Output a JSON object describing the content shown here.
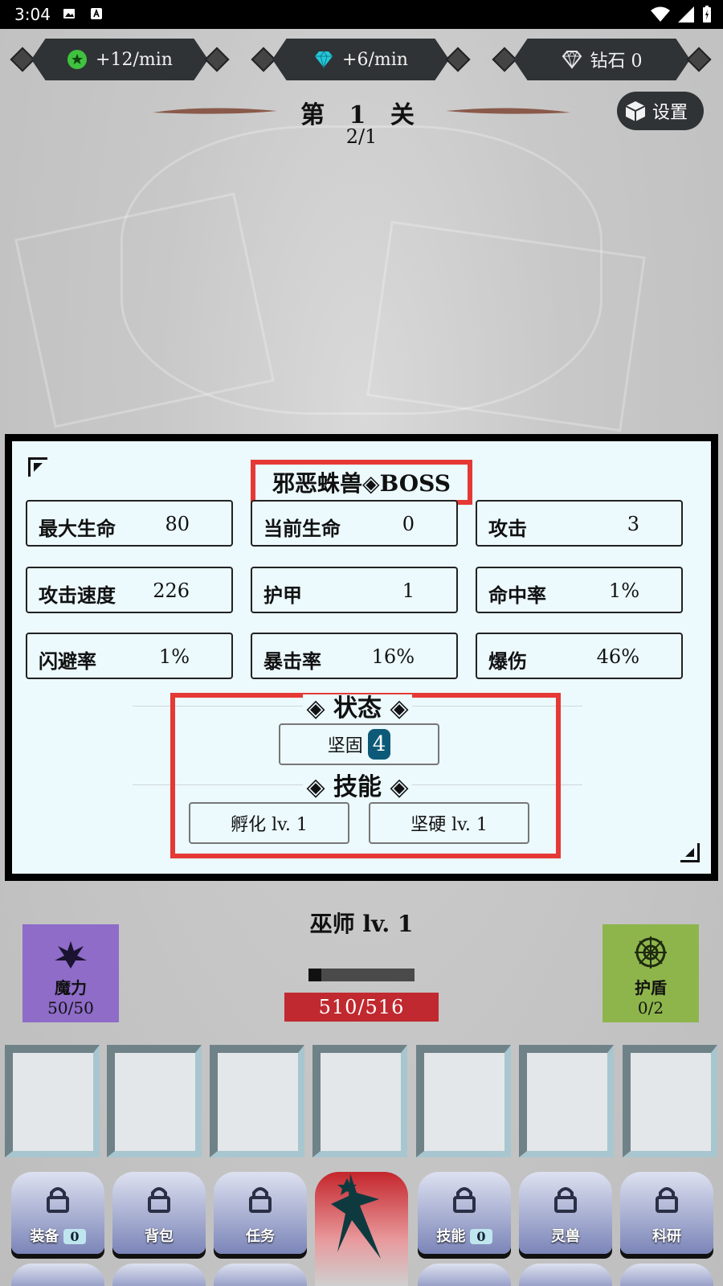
{
  "status_bar": {
    "time": "3:04"
  },
  "resources": [
    {
      "value": "+12/min",
      "icon": "green-star-coin-icon"
    },
    {
      "value": "+6/min",
      "icon": "cyan-gem-icon"
    },
    {
      "value": "钻石 0",
      "icon": "diamond-outline-icon"
    }
  ],
  "stage": {
    "title": "第 1 关",
    "progress": "2/1"
  },
  "settings": {
    "label": "设置"
  },
  "boss": {
    "name": "邪恶蛛兽◈BOSS",
    "stats": [
      {
        "label": "最大生命",
        "value": "80"
      },
      {
        "label": "当前生命",
        "value": "0"
      },
      {
        "label": "攻击",
        "value": "3"
      },
      {
        "label": "攻击速度",
        "value": "226"
      },
      {
        "label": "护甲",
        "value": "1"
      },
      {
        "label": "命中率",
        "value": "1%"
      },
      {
        "label": "闪避率",
        "value": "1%"
      },
      {
        "label": "暴击率",
        "value": "16%"
      },
      {
        "label": "爆伤",
        "value": "46%"
      }
    ],
    "status_header": "状态",
    "status_effects": [
      {
        "label": "坚固",
        "count": "4"
      }
    ],
    "skills_header": "技能",
    "skills": [
      {
        "label": "孵化 lv. 1"
      },
      {
        "label": "坚硬 lv. 1"
      }
    ]
  },
  "player": {
    "name": "巫师 lv. 1",
    "hp": "510/516",
    "exp_fraction": 0.12,
    "mana": {
      "label": "魔力",
      "value": "50/50"
    },
    "shield": {
      "label": "护盾",
      "value": "0/2"
    }
  },
  "menu": [
    {
      "label": "装备",
      "badge": "0"
    },
    {
      "label": "背包"
    },
    {
      "label": "任务"
    },
    {
      "label": "技能",
      "badge": "0"
    },
    {
      "label": "灵兽"
    },
    {
      "label": "科研"
    }
  ],
  "colors": {
    "highlight_red": "#e53935",
    "dialog_bg": "#ecf9fd",
    "hp_red": "#c0292f",
    "mana_purple": "#8e6cc8",
    "shield_green": "#8eb54b",
    "count_badge": "#0d5a78"
  }
}
